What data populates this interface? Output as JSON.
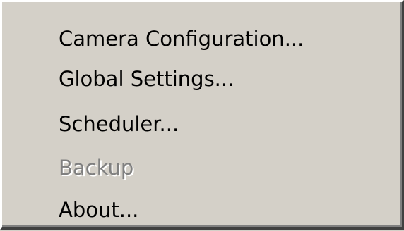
{
  "menu": {
    "items": [
      {
        "label": "Camera Configuration...",
        "enabled": true
      },
      {
        "label": "Global Settings...",
        "enabled": true
      },
      {
        "label": "Scheduler...",
        "enabled": true
      },
      {
        "label": "Backup",
        "enabled": false
      },
      {
        "label": "About...",
        "enabled": true
      }
    ]
  },
  "colors": {
    "menu_background": "#d4d0c8",
    "text": "#000000",
    "disabled_text": "#808080",
    "highlight_border": "#ffffff",
    "shadow_border": "#404040"
  }
}
